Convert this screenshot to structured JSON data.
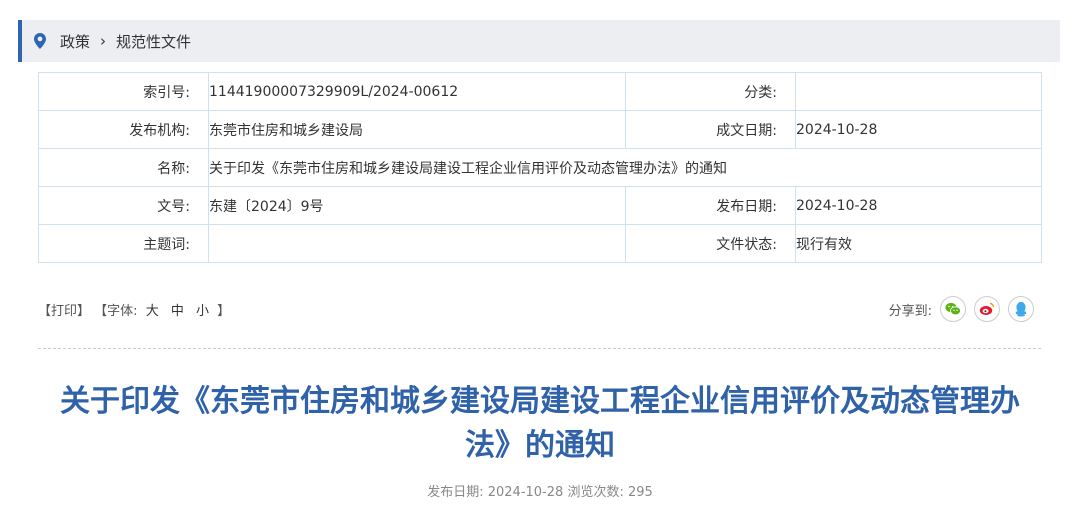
{
  "breadcrumb": {
    "item1": "政策",
    "separator": "›",
    "item2": "规范性文件"
  },
  "meta": {
    "index_label": "索引号:",
    "index_value": "11441900007329909L/2024-00612",
    "category_label": "分类:",
    "category_value": "",
    "publisher_label": "发布机构:",
    "publisher_value": "东莞市住房和城乡建设局",
    "written_date_label": "成文日期:",
    "written_date_value": "2024-10-28",
    "name_label": "名称:",
    "name_value": "关于印发《东莞市住房和城乡建设局建设工程企业信用评价及动态管理办法》的通知",
    "doc_no_label": "文号:",
    "doc_no_value": "东建〔2024〕9号",
    "publish_date_label": "发布日期:",
    "publish_date_value": "2024-10-28",
    "subject_label": "主题词:",
    "subject_value": "",
    "status_label": "文件状态:",
    "status_value": "现行有效"
  },
  "tools": {
    "print": "【打印】",
    "font_prefix": "【字体:",
    "font_large": "大",
    "font_medium": "中",
    "font_small": "小",
    "font_suffix": "】"
  },
  "share": {
    "label": "分享到:",
    "icons": [
      "wechat-icon",
      "weibo-icon",
      "qq-icon"
    ],
    "colors": {
      "wechat": "#5bb318",
      "weibo": "#e6162d",
      "qq": "#3fa9e8"
    }
  },
  "article": {
    "title": "关于印发《东莞市住房和城乡建设局建设工程企业信用评价及动态管理办法》的通知",
    "publish_label": "发布日期:",
    "publish_date": "2024-10-28",
    "views_label": "浏览次数:",
    "views": "295"
  },
  "colors": {
    "accent": "#2d64b3",
    "title": "#2f62a8",
    "table_border": "#cfe0ee"
  }
}
